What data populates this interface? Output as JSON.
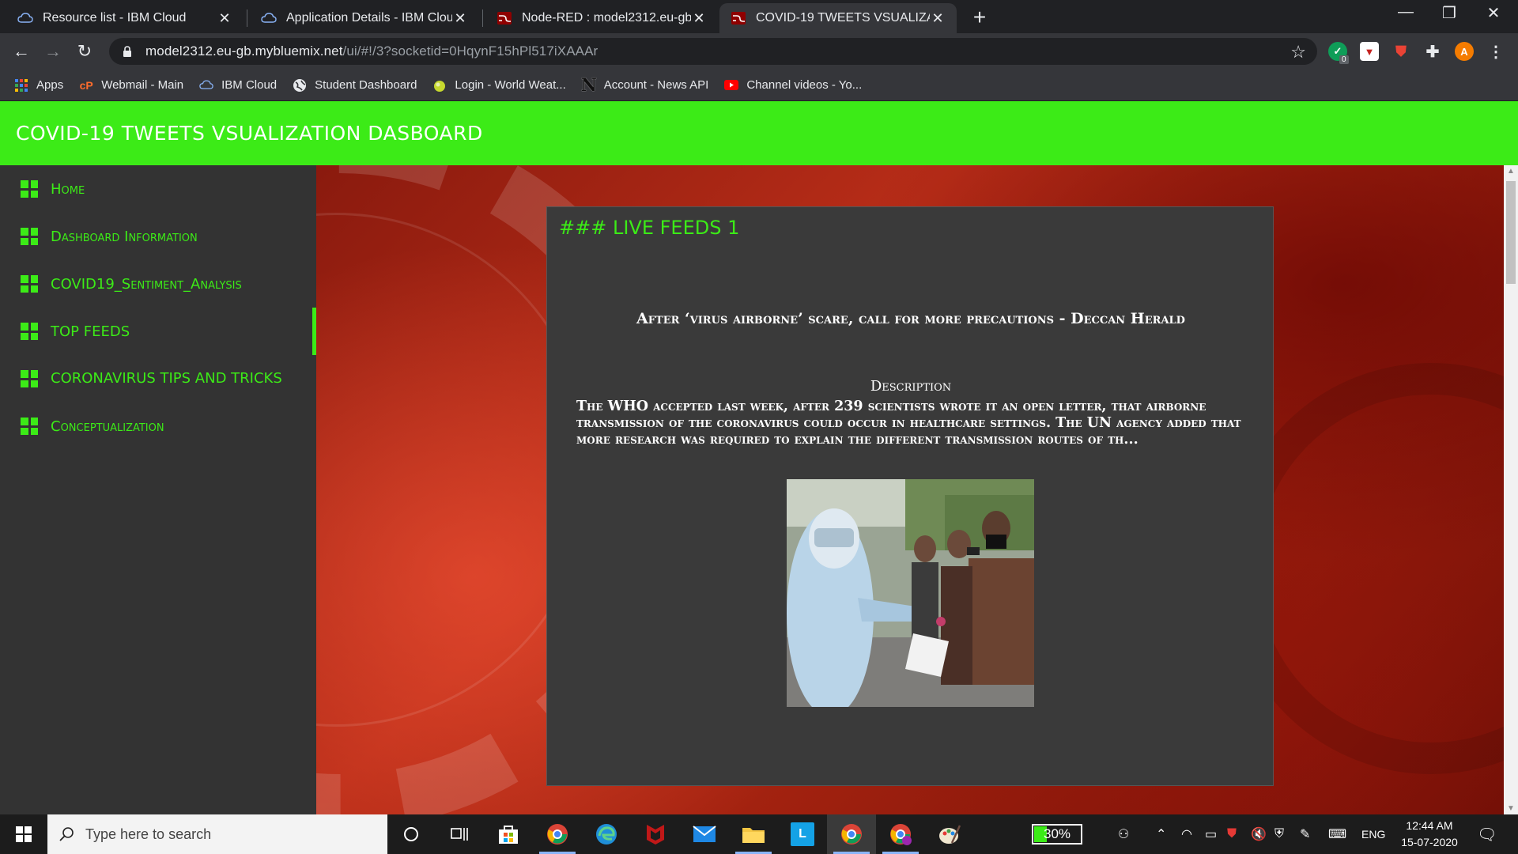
{
  "browser": {
    "tabs": [
      {
        "title": "Resource list - IBM Cloud",
        "icon": "ibm-cloud-icon"
      },
      {
        "title": "Application Details - IBM Cloud",
        "icon": "ibm-cloud-icon"
      },
      {
        "title": "Node-RED : model2312.eu-gb.m",
        "icon": "node-red-icon"
      },
      {
        "title": "COVID-19 TWEETS VSUALIZATIO",
        "icon": "node-red-icon",
        "active": true
      }
    ],
    "url_host": "model2312.eu-gb.mybluemix.net",
    "url_path": "/ui/#!/3?socketid=0HqynF15hPl517iXAAAr",
    "extension_badge": "0",
    "avatar_letter": "A",
    "bookmarks": [
      {
        "label": "Apps",
        "icon": "apps-grid-icon"
      },
      {
        "label": "Webmail - Main",
        "icon": "cpanel-icon"
      },
      {
        "label": "IBM Cloud",
        "icon": "ibm-cloud-icon"
      },
      {
        "label": "Student Dashboard",
        "icon": "globe-icon"
      },
      {
        "label": "Login - World Weat...",
        "icon": "weather-icon"
      },
      {
        "label": "Account - News API",
        "icon": "news-n-icon"
      },
      {
        "label": "Channel videos - Yo...",
        "icon": "youtube-icon"
      }
    ]
  },
  "app": {
    "title": "COVID-19 TWEETS VSUALIZATION DASBOARD",
    "accent": "#3ceb17",
    "nav": [
      {
        "label": "Home",
        "active": false
      },
      {
        "label": "Dashboard Information",
        "active": false
      },
      {
        "label": "COVID19_Sentiment_Analysis",
        "active": false
      },
      {
        "label": "TOP FEEDS",
        "active": true
      },
      {
        "label": "CORONAVIRUS TIPS AND TRICKS",
        "active": false
      },
      {
        "label": "Conceptualization",
        "active": false
      }
    ],
    "panel": {
      "title": "### LIVE FEEDS 1",
      "headline": "After ‘virus airborne’ scare, call for more precautions - Deccan Herald",
      "description_label": "Description",
      "description": "The WHO accepted last week, after 239 scientists wrote it an open letter, that airborne transmission of the coronavirus could occur in healthcare settings.  The UN agency added that more research was required to explain the different transmission routes of th..."
    }
  },
  "taskbar": {
    "search_placeholder": "Type here to search",
    "battery": "30%",
    "language": "ENG",
    "time": "12:44 AM",
    "date": "15-07-2020"
  }
}
